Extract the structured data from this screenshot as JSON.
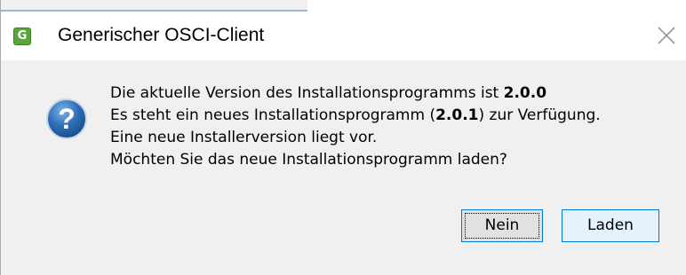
{
  "window": {
    "title": "Generischer OSCI-Client",
    "app_icon_letter": "G"
  },
  "message": {
    "line1_text": "Die aktuelle Version des Installationsprogramms ist ",
    "line1_version": "2.0.0",
    "line2_prefix": "Es steht ein neues Installationsprogramm (",
    "line2_version": "2.0.1",
    "line2_suffix": ") zur Verfügung.",
    "line3": "Eine neue Installerversion liegt vor.",
    "line4": "Möchten Sie das neue Installationsprogramm laden?"
  },
  "buttons": {
    "no_label": "Nein",
    "load_label": "Laden"
  },
  "icons": {
    "app": "app-logo-icon",
    "close": "close-icon",
    "question": "question-icon"
  },
  "colors": {
    "accent": "#0078d7",
    "question_icon": "#2f6fb7",
    "app_icon": "#5aa63a"
  }
}
